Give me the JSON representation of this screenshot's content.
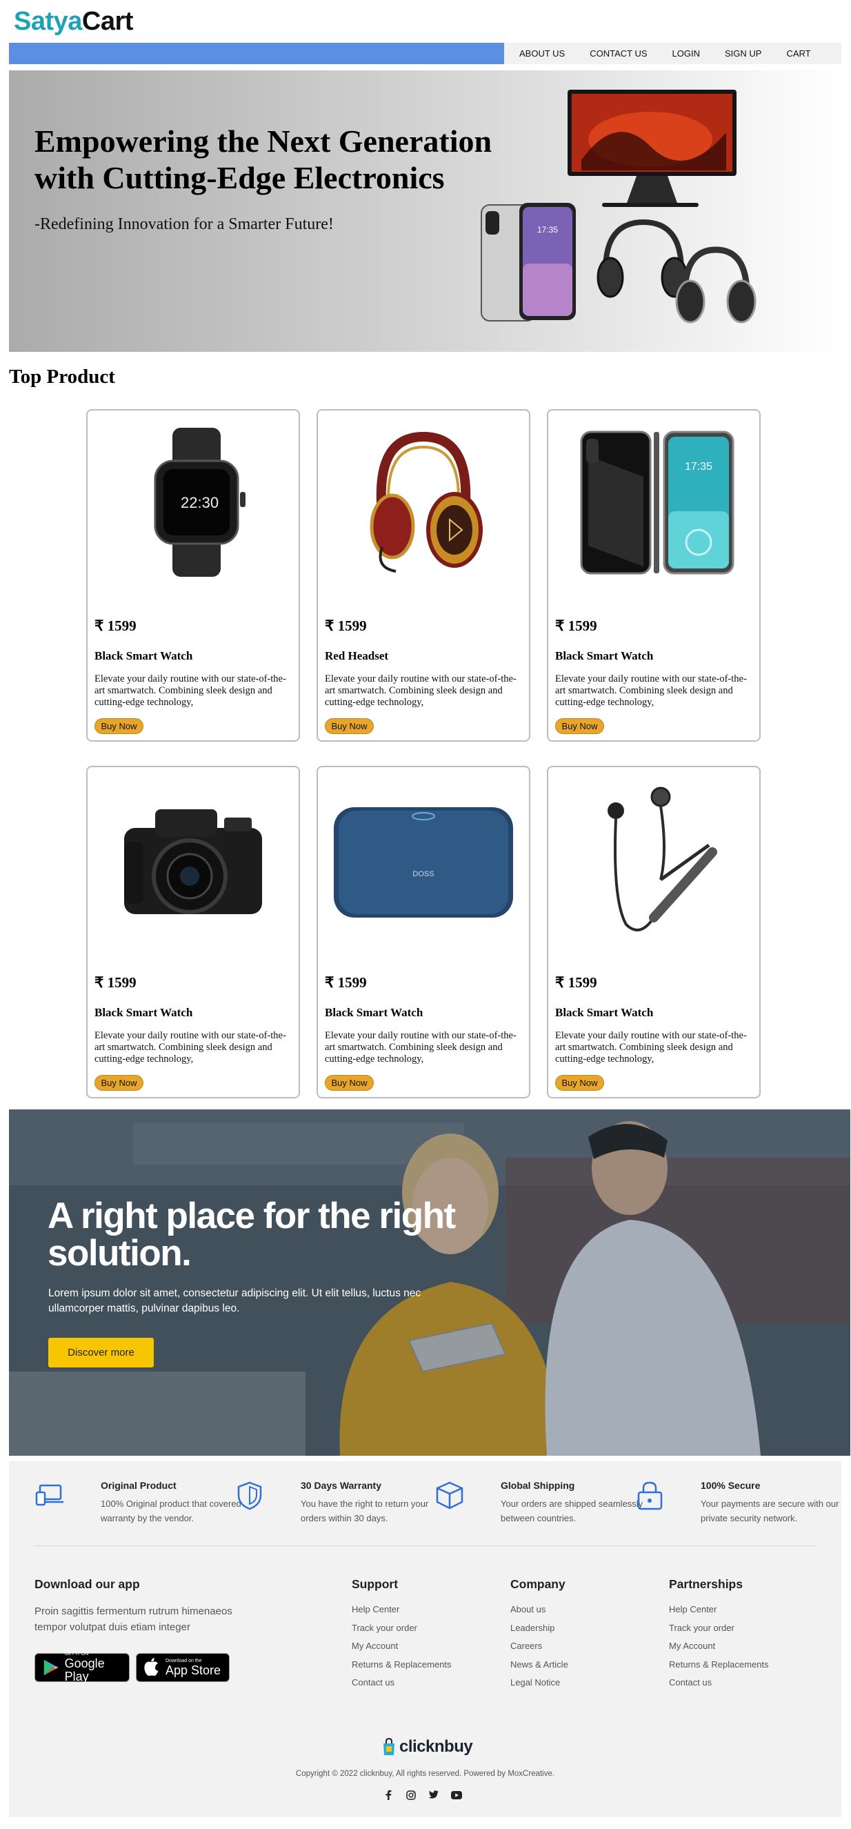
{
  "header": {
    "logo_part1": "Satya",
    "logo_part2": "Cart",
    "nav": [
      "ABOUT US",
      "CONTACT US",
      "LOGIN",
      "SIGN UP",
      "CART"
    ]
  },
  "hero": {
    "title": "Empowering the Next Generation with Cutting-Edge Electronics",
    "subtitle": "-Redefining Innovation for a Smarter Future!"
  },
  "products_section": {
    "title": "Top Product",
    "buy_label": "Buy Now",
    "items": [
      {
        "price": "₹ 1599",
        "name": "Black Smart Watch",
        "desc": "Elevate your daily routine with our state-of-the-art smartwatch. Combining sleek design and cutting-edge technology,",
        "image": "smartwatch-image"
      },
      {
        "price": "₹ 1599",
        "name": "Red Headset",
        "desc": "Elevate your daily routine with our state-of-the-art smartwatch. Combining sleek design and cutting-edge technology,",
        "image": "headset-image"
      },
      {
        "price": "₹ 1599",
        "name": "Black Smart Watch",
        "desc": "Elevate your daily routine with our state-of-the-art smartwatch. Combining sleek design and cutting-edge technology,",
        "image": "smartphone-image"
      },
      {
        "price": "₹ 1599",
        "name": "Black Smart Watch",
        "desc": "Elevate your daily routine with our state-of-the-art smartwatch. Combining sleek design and cutting-edge technology,",
        "image": "camera-image"
      },
      {
        "price": "₹ 1599",
        "name": "Black Smart Watch",
        "desc": "Elevate your daily routine with our state-of-the-art smartwatch. Combining sleek design and cutting-edge technology,",
        "image": "speaker-image"
      },
      {
        "price": "₹ 1599",
        "name": "Black Smart Watch",
        "desc": "Elevate your daily routine with our state-of-the-art smartwatch. Combining sleek design and cutting-edge technology,",
        "image": "earphones-image"
      }
    ]
  },
  "promo": {
    "title": "A right place for the right solution.",
    "text": "Lorem ipsum dolor sit amet, consectetur adipiscing elit. Ut elit tellus, luctus nec ullamcorper mattis, pulvinar dapibus leo.",
    "button": "Discover more"
  },
  "footer": {
    "features": [
      {
        "title": "Original Product",
        "desc": "100% Original product that covered warranty by the vendor.",
        "icon": "devices-icon"
      },
      {
        "title": "30 Days Warranty",
        "desc": "You have the right to return your orders within 30 days.",
        "icon": "shield-icon"
      },
      {
        "title": "Global Shipping",
        "desc": "Your orders are shipped seamlessly between countries.",
        "icon": "box-icon"
      },
      {
        "title": "100% Secure",
        "desc": "Your payments are secure with our private security network.",
        "icon": "lock-icon"
      }
    ],
    "app": {
      "title": "Download our app",
      "desc": "Proin sagittis fermentum rutrum himenaeos tempor volutpat duis etiam integer",
      "google_small": "GET IT ON",
      "google_big": "Google Play",
      "apple_small": "Download on the",
      "apple_big": "App Store"
    },
    "columns": [
      {
        "title": "Support",
        "links": [
          "Help Center",
          "Track your order",
          "My Account",
          "Returns & Replacements",
          "Contact us"
        ]
      },
      {
        "title": "Company",
        "links": [
          "About us",
          "Leadership",
          "Careers",
          "News & Article",
          "Legal Notice"
        ]
      },
      {
        "title": "Partnerships",
        "links": [
          "Help Center",
          "Track your order",
          "My Account",
          "Returns & Replacements",
          "Contact us"
        ]
      }
    ],
    "brand": "clicknbuy",
    "copyright": "Copyright © 2022 clicknbuy, All rights reserved. Powered by MoxCreative.",
    "social": [
      "facebook-icon",
      "instagram-icon",
      "twitter-icon",
      "youtube-icon"
    ]
  },
  "colors": {
    "logo_accent": "#1fa2b8",
    "nav_blue": "#5a8fe3",
    "buy_button": "#e7a52a",
    "promo_button": "#f7c600",
    "feature_icon": "#2f6fd6"
  }
}
